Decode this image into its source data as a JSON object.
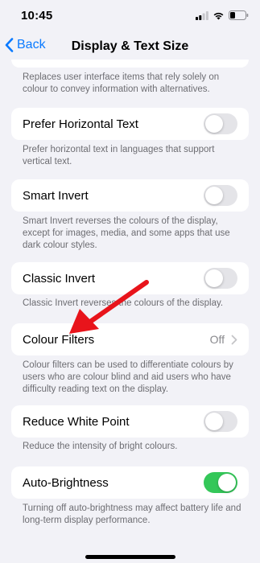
{
  "status_bar": {
    "time": "10:45"
  },
  "nav": {
    "back_label": "Back",
    "title": "Display & Text Size"
  },
  "top_caption": "Replaces user interface items that rely solely on colour to convey information with alternatives.",
  "settings": [
    {
      "label": "Prefer Horizontal Text",
      "toggle": "off",
      "caption": "Prefer horizontal text in languages that support vertical text."
    },
    {
      "label": "Smart Invert",
      "toggle": "off",
      "caption": "Smart Invert reverses the colours of the display, except for images, media, and some apps that use dark colour styles."
    },
    {
      "label": "Classic Invert",
      "toggle": "off",
      "caption": "Classic Invert reverses the colours of the display."
    },
    {
      "label": "Colour Filters",
      "value": "Off",
      "caption": "Colour filters can be used to differentiate colours by users who are colour blind and aid users who have difficulty reading text on the display."
    },
    {
      "label": "Reduce White Point",
      "toggle": "off",
      "caption": "Reduce the intensity of bright colours."
    },
    {
      "label": "Auto-Brightness",
      "toggle": "on",
      "caption": "Turning off auto-brightness may affect battery life and long-term display performance."
    }
  ],
  "colors": {
    "accent": "#0a7aff",
    "toggle_on": "#34c759",
    "annotation_arrow": "#e8141b"
  }
}
